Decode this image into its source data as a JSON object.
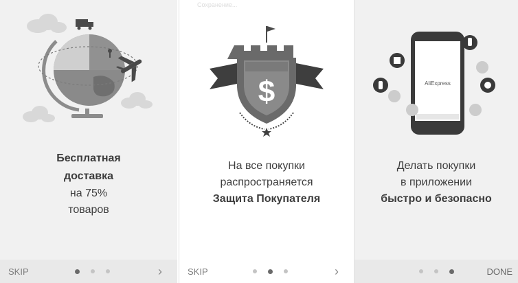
{
  "panels": [
    {
      "caption_bold": "Бесплатная доставка",
      "caption_lines": [
        "на 75%",
        "товаров"
      ],
      "skip_label": "SKIP",
      "next_label": "›",
      "ghost_status": ""
    },
    {
      "caption_lines": [
        "На все покупки",
        "распространяется"
      ],
      "caption_bold": "Защита Покупателя",
      "skip_label": "SKIP",
      "next_label": "›",
      "ghost_status": "Сохранение..."
    },
    {
      "caption_lines": [
        "Делать покупки",
        "в приложении"
      ],
      "caption_bold": "быстро и безопасно",
      "done_label": "DONE",
      "ghost_status": "",
      "phone_logo": "AliExpress"
    }
  ],
  "colors": {
    "panel_bg": "#f1f1f1",
    "footer_bg": "#e9e9e9",
    "text": "#3d3d3d",
    "dot_active": "#6a6a6a",
    "dot_inactive": "#c4c4c4"
  }
}
